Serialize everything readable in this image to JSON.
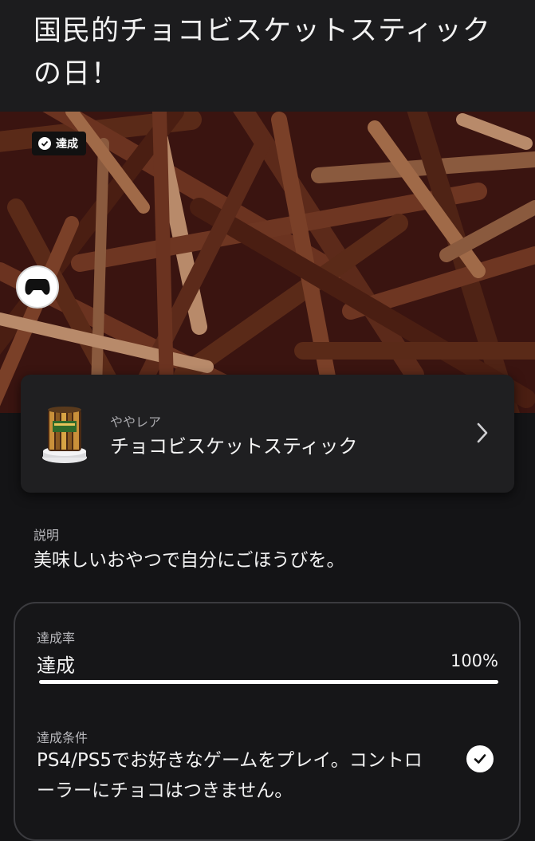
{
  "header": {
    "title": "国民的チョコビスケットスティックの日！"
  },
  "hero": {
    "badge_label": "達成",
    "badge_icon": "check-circle-icon",
    "platform_icon": "gamepad-icon",
    "background_color": "#3a1410"
  },
  "trophy_card": {
    "rarity": "ややレア",
    "name": "チョコビスケットスティック",
    "chevron_icon": "chevron-right-icon"
  },
  "description": {
    "label": "説明",
    "text": "美味しいおやつで自分にごほうびを。"
  },
  "progress": {
    "label": "達成率",
    "status": "達成",
    "percent_text": "100%",
    "fraction": 1.0
  },
  "condition": {
    "label": "達成条件",
    "text": "PS4/PS5でお好きなゲームをプレイ。コントローラーにチョコはつきません。",
    "check_icon": "check-circle-icon"
  }
}
